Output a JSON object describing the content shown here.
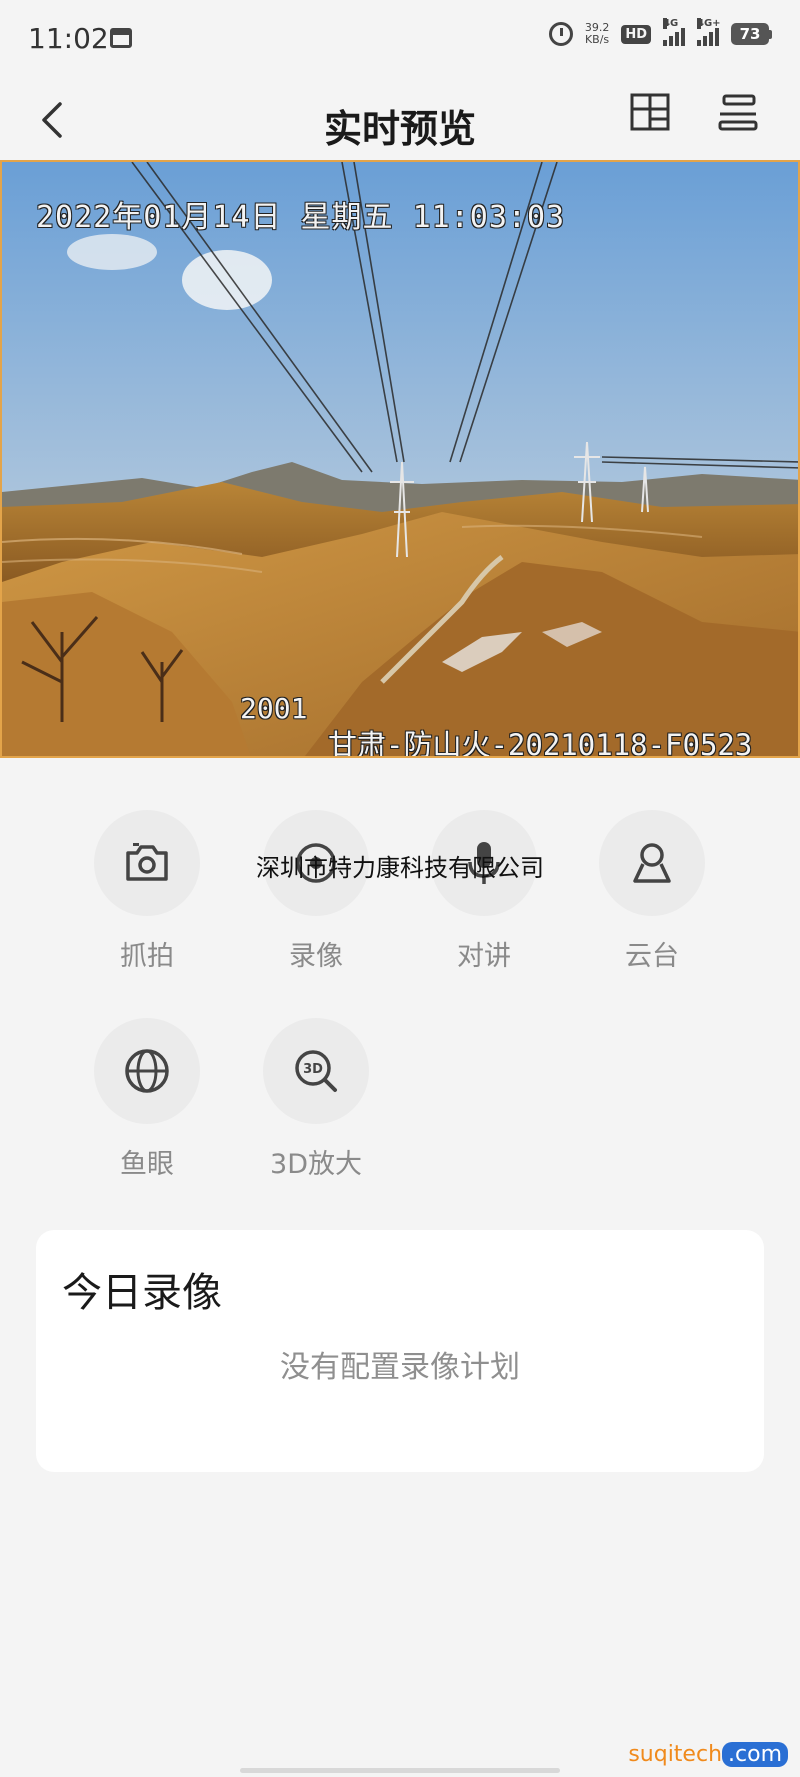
{
  "status_bar": {
    "time": "11:02",
    "net_speed_value": "39.2",
    "net_speed_unit": "KB/s",
    "hd_label": "HD",
    "sim1_label": "4G",
    "sim2_label": "4G+",
    "battery": "73"
  },
  "header": {
    "title": "实时预览"
  },
  "video": {
    "osd_timestamp": "2022年01月14日  星期五  11:03:03",
    "osd_channel": "2001",
    "osd_device_name": "甘肃-防山火-20210118-F0523"
  },
  "actions": [
    {
      "label": "抓拍",
      "icon": "camera-icon"
    },
    {
      "label": "录像",
      "icon": "record-icon"
    },
    {
      "label": "对讲",
      "icon": "microphone-icon"
    },
    {
      "label": "云台",
      "icon": "ptz-icon"
    },
    {
      "label": "鱼眼",
      "icon": "fisheye-globe-icon"
    },
    {
      "label": "3D放大",
      "icon": "3d-zoom-icon"
    }
  ],
  "watermark": "深圳市特力康科技有限公司",
  "today_record": {
    "title": "今日录像",
    "empty_text": "没有配置录像计划"
  },
  "site_mark": {
    "part1": "suqitech",
    "part2": ".com"
  },
  "colors": {
    "video_border": "#e3a44a",
    "background": "#f4f4f4"
  }
}
